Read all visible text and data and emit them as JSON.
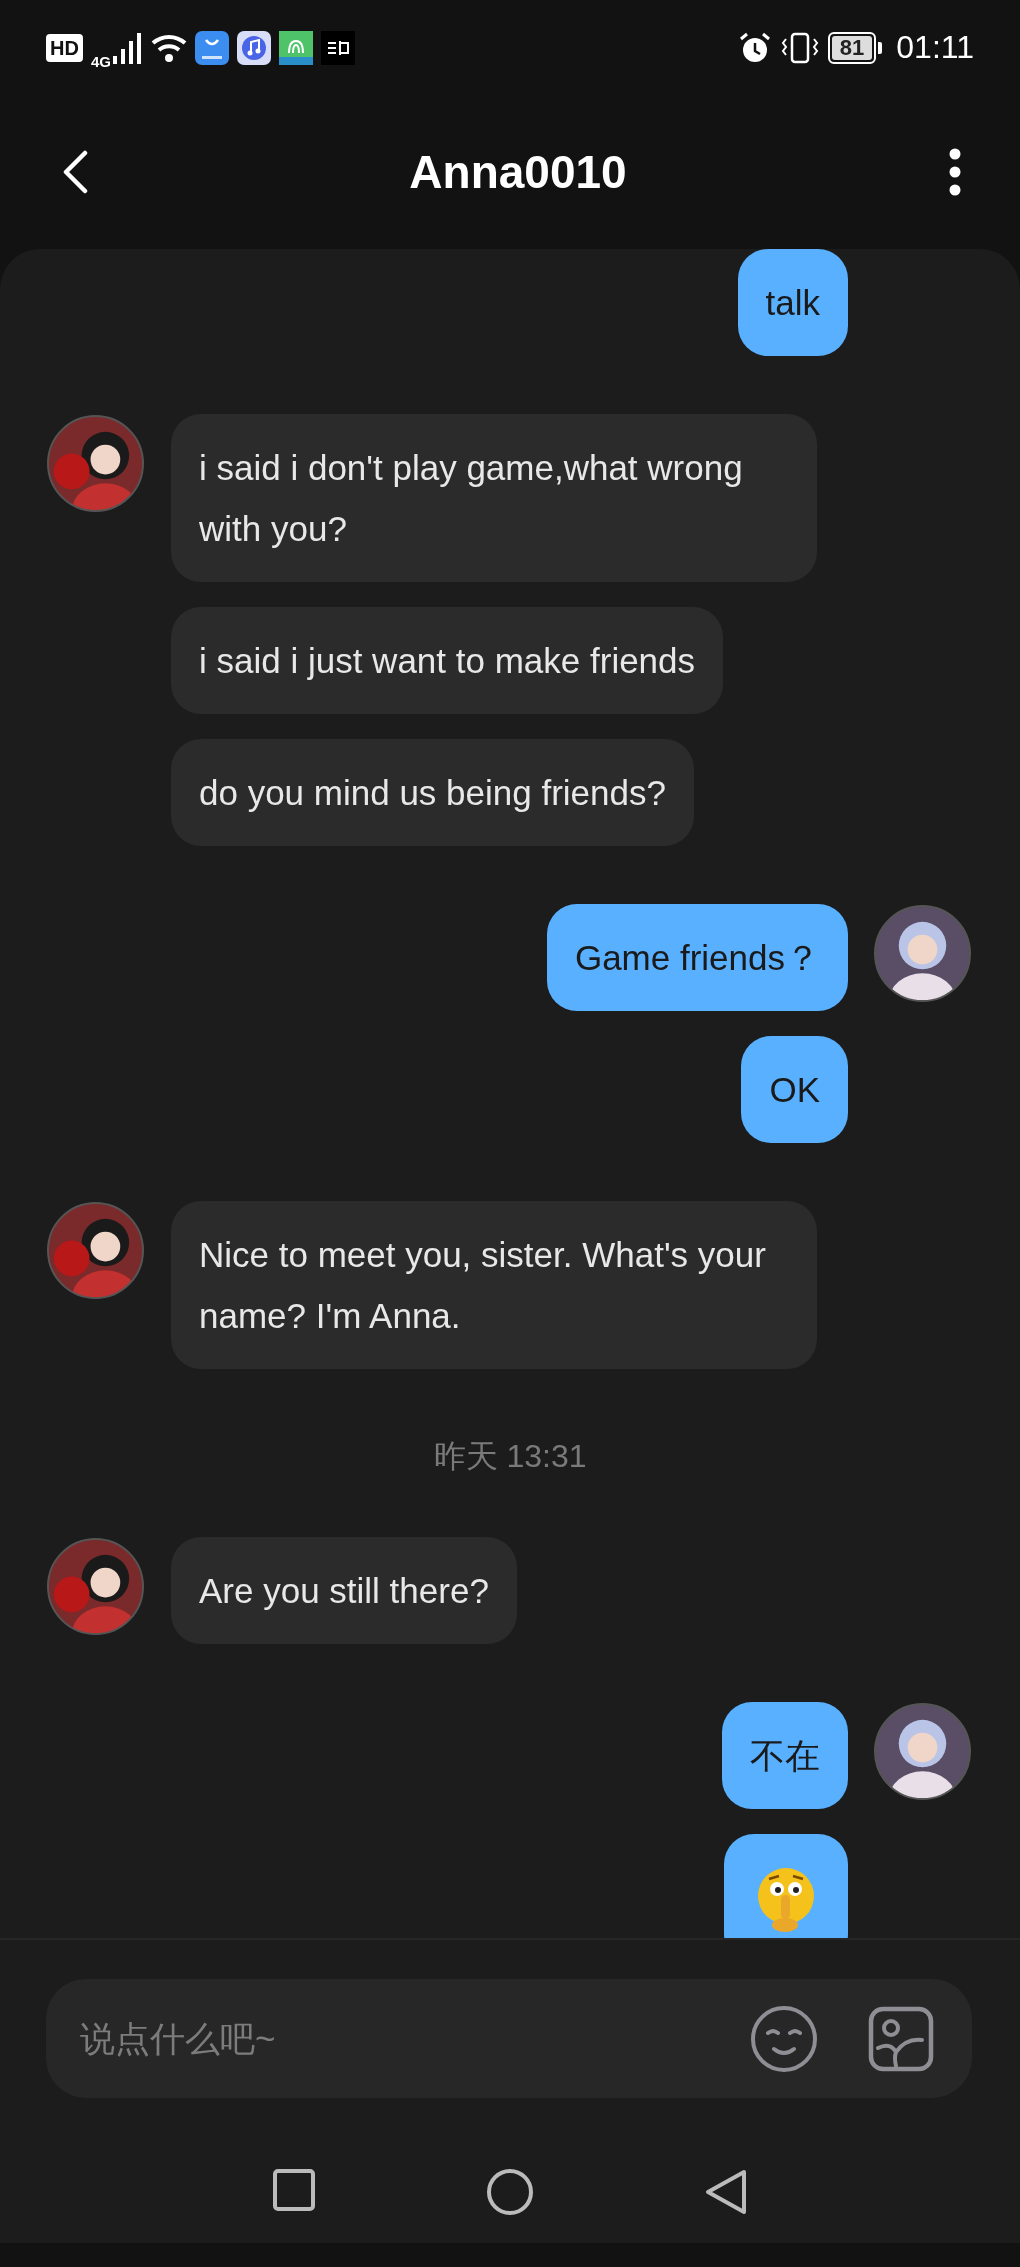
{
  "status_bar": {
    "hd": "HD",
    "network": "4G",
    "battery": "81",
    "time": "01:11"
  },
  "header": {
    "title": "Anna0010"
  },
  "messages": [
    {
      "kind": "outgoing",
      "show_avatar": false,
      "text": "talk"
    },
    {
      "kind": "incoming",
      "show_avatar": true,
      "text": "i said i don't play game,what wrong with you?"
    },
    {
      "kind": "incoming",
      "show_avatar": false,
      "text": "i said i just want to make friends"
    },
    {
      "kind": "incoming",
      "show_avatar": false,
      "text": "do you mind us being friends?"
    },
    {
      "kind": "outgoing",
      "show_avatar": true,
      "text": "Game friends？"
    },
    {
      "kind": "outgoing",
      "show_avatar": false,
      "text": "OK"
    },
    {
      "kind": "incoming",
      "show_avatar": true,
      "text": "Nice to meet you, sister. What's your name? I'm Anna."
    },
    {
      "kind": "timestamp",
      "text": "昨天 13:31"
    },
    {
      "kind": "incoming",
      "show_avatar": true,
      "text": "Are you still there?"
    },
    {
      "kind": "outgoing",
      "show_avatar": true,
      "text": "不在"
    },
    {
      "kind": "sticker",
      "show_avatar": false
    }
  ],
  "composer": {
    "placeholder": "说点什么吧~"
  }
}
